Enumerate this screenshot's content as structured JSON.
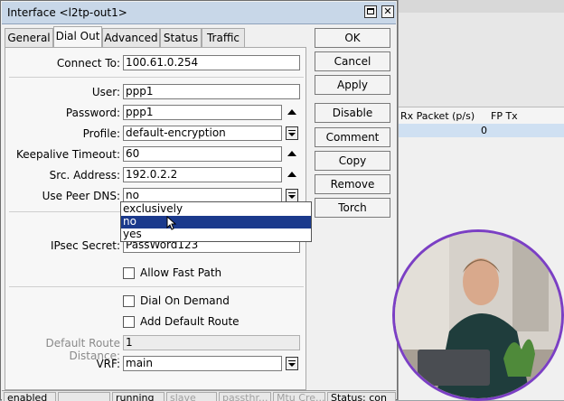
{
  "dialog": {
    "title": "Interface <l2tp-out1>",
    "tabs": [
      "General",
      "Dial Out",
      "Advanced",
      "Status",
      "Traffic"
    ],
    "active_tab": "Dial Out",
    "fields": {
      "connect_to": {
        "label": "Connect To:",
        "value": "100.61.0.254"
      },
      "user": {
        "label": "User:",
        "value": "ppp1"
      },
      "password": {
        "label": "Password:",
        "value": "ppp1"
      },
      "profile": {
        "label": "Profile:",
        "value": "default-encryption"
      },
      "keepalive": {
        "label": "Keepalive Timeout:",
        "value": "60"
      },
      "src_address": {
        "label": "Src. Address:",
        "value": "192.0.2.2"
      },
      "use_peer_dns": {
        "label": "Use Peer DNS:",
        "value": "no"
      },
      "ipsec_secret": {
        "label": "IPsec Secret:",
        "value": "PassWord123"
      },
      "default_route_distance": {
        "label": "Default Route Distance:",
        "value": "1"
      },
      "vrf": {
        "label": "VRF:",
        "value": "main"
      }
    },
    "checkboxes": {
      "allow_fast_path": {
        "label": "Allow Fast Path",
        "checked": false
      },
      "dial_on_demand": {
        "label": "Dial On Demand",
        "checked": false
      },
      "add_default_route": {
        "label": "Add Default Route",
        "checked": false
      }
    },
    "dropdown_options": [
      "exclusively",
      "no",
      "yes"
    ],
    "dropdown_selected": "no",
    "buttons": {
      "ok": "OK",
      "cancel": "Cancel",
      "apply": "Apply",
      "disable": "Disable",
      "comment": "Comment",
      "copy": "Copy",
      "remove": "Remove",
      "torch": "Torch"
    },
    "status_bar": [
      "enabled",
      "",
      "running",
      "slave",
      "passthr...",
      "Mtu Cre...",
      "Status: con"
    ]
  },
  "background_table": {
    "headers": [
      "Rx Packet (p/s)",
      "FP Tx"
    ],
    "row": [
      "0",
      ""
    ]
  },
  "colors": {
    "titlebar": "#c8d7e8",
    "selection": "#1b3a8c",
    "webcam_ring": "#7b3fc4"
  }
}
